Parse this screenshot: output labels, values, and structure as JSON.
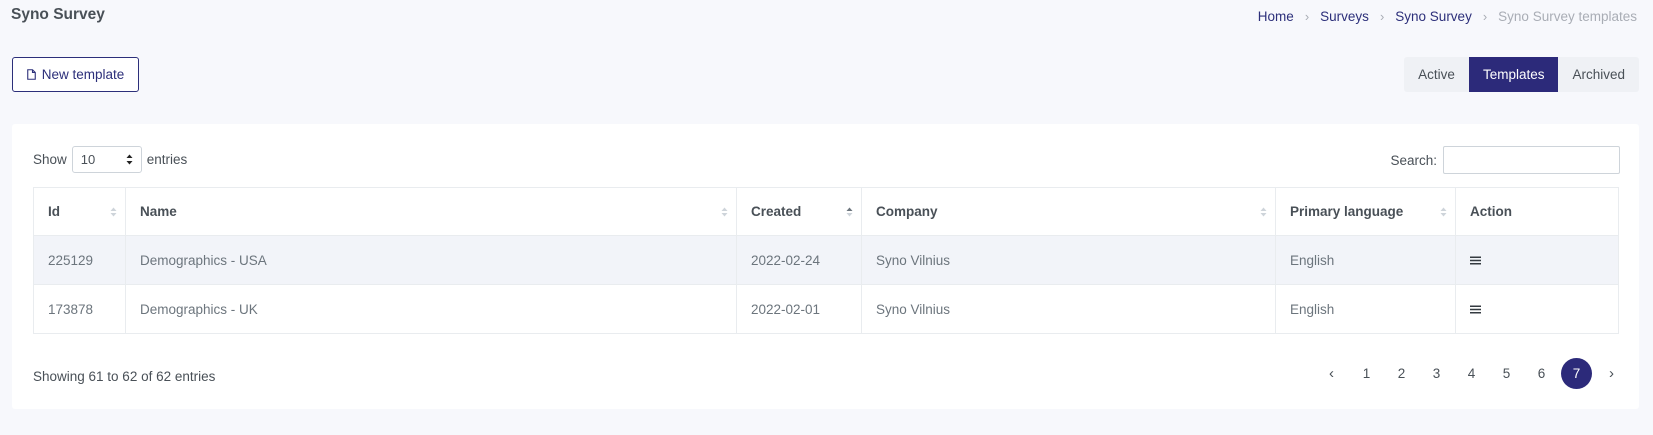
{
  "header": {
    "title": "Syno Survey",
    "breadcrumb": [
      "Home",
      "Surveys",
      "Syno Survey",
      "Syno Survey templates"
    ]
  },
  "toolbar": {
    "new_template_label": "New template",
    "tabs": [
      "Active",
      "Templates",
      "Archived"
    ],
    "active_tab": "Templates"
  },
  "table_controls": {
    "show_label": "Show",
    "entries_value": "10",
    "entries_label": "entries",
    "search_label": "Search:",
    "search_value": ""
  },
  "table": {
    "columns": [
      "Id",
      "Name",
      "Created",
      "Company",
      "Primary language",
      "Action"
    ],
    "rows": [
      [
        "225129",
        "Demographics - USA",
        "2022-02-24",
        "Syno Vilnius",
        "English"
      ],
      [
        "173878",
        "Demographics - UK",
        "2022-02-01",
        "Syno Vilnius",
        "English"
      ]
    ],
    "sorted_column": "Created",
    "sort_direction": "ascending"
  },
  "footer": {
    "info": "Showing 61 to 62 of 62 entries",
    "pages": [
      "1",
      "2",
      "3",
      "4",
      "5",
      "6",
      "7"
    ],
    "current_page": "7",
    "prev_symbol": "‹",
    "next_symbol": "›"
  },
  "colors": {
    "primary": "#2c2a7a",
    "background": "#f7f8fc",
    "muted_text": "#a9adb5"
  },
  "icons": {
    "new_template": "document-icon",
    "action": "hamburger-menu-icon"
  }
}
